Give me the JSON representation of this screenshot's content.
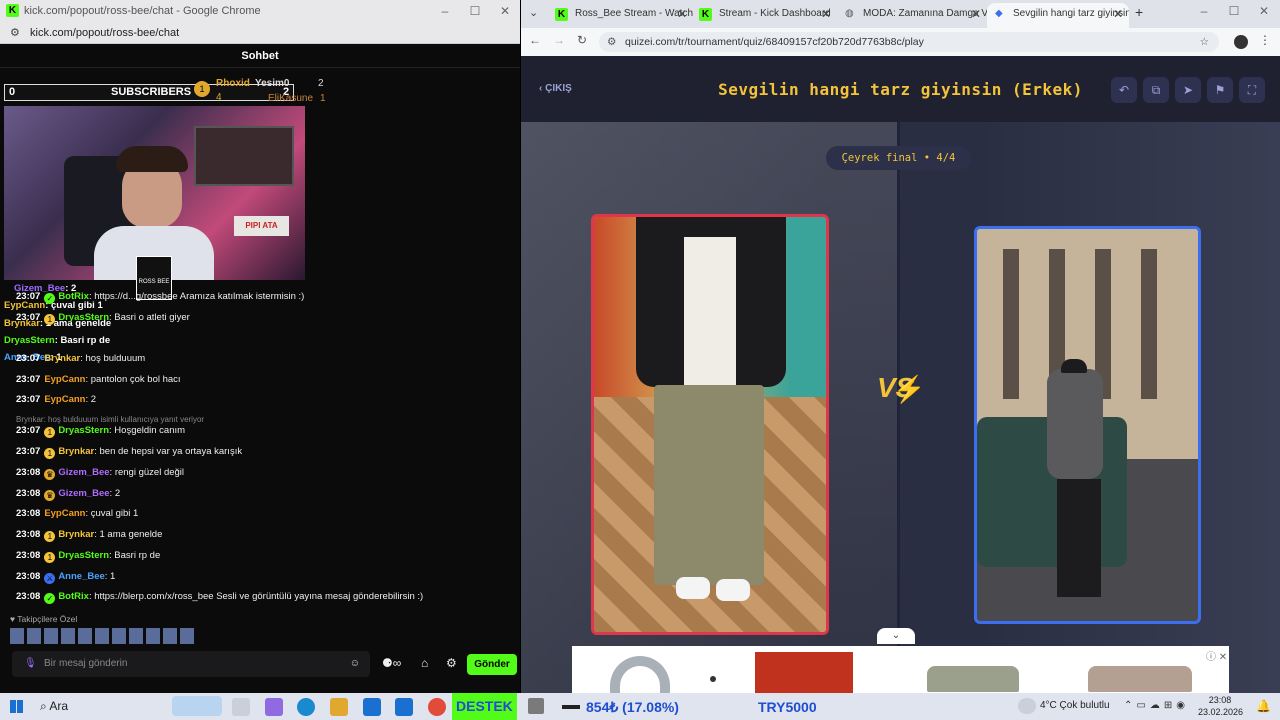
{
  "left_window": {
    "title": "kick.com/popout/ross-bee/chat - Google Chrome",
    "url": "kick.com/popout/ross-bee/chat",
    "chat_header": "Sohbet",
    "overlay": {
      "subs_count": "0",
      "subs_label": "SUBSCRIBERS",
      "subs_right": "2",
      "leader1": "Rhoxid",
      "leader1_count": "4",
      "leader2": "Yesim0",
      "leader2_count": "2",
      "leader3": "EliKasune",
      "leader3_count": "1",
      "stream_logo": "ROSS BEE"
    },
    "overlay_messages": [
      {
        "user": "Gizem_Bee",
        "text": ": 2",
        "color": "#a06bff"
      },
      {
        "user": "EypCann",
        "text": ": çuval gibi 1",
        "color": "#f3c43a"
      },
      {
        "user": "Brynkar",
        "text": ": 1 ama genelde",
        "color": "#f3c43a"
      },
      {
        "user": "DryasStern",
        "text": ": Basri rp de",
        "color": "#53fc18"
      },
      {
        "user": "Anne_Bee",
        "text": ": 1",
        "color": "#4aa3ff"
      }
    ],
    "messages": [
      {
        "time": "23:07",
        "user": "BotRix",
        "text": ": https://d...g/rossbee Aramıza katılmak istermisin :)",
        "color": "#53fc18"
      },
      {
        "time": "23:07",
        "user": "DryasStern",
        "text": ": Basri o atleti giyer",
        "color": "#53fc18"
      },
      {
        "time": "23:07",
        "user": "Brynkar",
        "text": ": hoş bulduuum",
        "color": "#f3c43a"
      },
      {
        "time": "23:07",
        "user": "EypCann",
        "text": ": pantolon çok bol hacı",
        "color": "#f3a020"
      },
      {
        "time": "23:07",
        "user": "EypCann",
        "text": ": 2",
        "color": "#f3a020"
      },
      {
        "time": "23:07",
        "user": "DryasStern",
        "text": ": Hoşgeldin canım",
        "color": "#53fc18"
      },
      {
        "time": "23:07",
        "user": "Brynkar",
        "text": ": ben de hepsi var ya ortaya karışık",
        "color": "#f3c43a"
      },
      {
        "time": "23:08",
        "user": "Gizem_Bee",
        "text": ": rengi güzel değil",
        "color": "#b06bff"
      },
      {
        "time": "23:08",
        "user": "Gizem_Bee",
        "text": ": 2",
        "color": "#b06bff"
      },
      {
        "time": "23:08",
        "user": "EypCann",
        "text": ": çuval gibi 1",
        "color": "#f3a020"
      },
      {
        "time": "23:08",
        "user": "Brynkar",
        "text": ": 1 ama genelde",
        "color": "#f3c43a"
      },
      {
        "time": "23:08",
        "user": "DryasStern",
        "text": ": Basri rp de",
        "color": "#53fc18"
      },
      {
        "time": "23:08",
        "user": "Anne_Bee",
        "text": ": 1",
        "color": "#4aa3ff"
      },
      {
        "time": "23:08",
        "user": "BotRix",
        "text": ": https://blerp.com/x/ross_bee Sesli ve görüntülü yayına mesaj gönderebilirsin :)",
        "color": "#53fc18"
      }
    ],
    "reply_note": "Brynkar: hoş bulduuum isimli kullanıcıya yanıt veriyor",
    "emote_label": "Takipçilere Özel",
    "input_placeholder": "Bir mesaj gönderin",
    "send_label": "Gönder"
  },
  "right_window": {
    "tabs": [
      {
        "label": "Ross_Bee Stream - Watch Li",
        "icon": "kick-icon"
      },
      {
        "label": "Stream - Kick Dashboard",
        "icon": "kick-icon"
      },
      {
        "label": "MODA: Zamanına Damga V",
        "icon": "globe-icon"
      },
      {
        "label": "Sevgilin hangi tarz giyinsin",
        "icon": "quiz-icon"
      }
    ],
    "url": "quizei.com/tr/tournament/quiz/68409157cf20b720d7763b8c/play",
    "exit_label": "ÇIKIŞ",
    "quiz_title": "Sevgilin hangi tarz giyinsin (Erkek)",
    "round_label": "Çeyrek final • 4/4",
    "vs_label": "VS"
  },
  "taskbar": {
    "search_label": "Ara",
    "ticker1": "DESTEK",
    "ticker2": "854₺ (17.08%)",
    "ticker3": "TRY5000",
    "weather": "4°C  Çok bulutlu",
    "time": "23:08",
    "date": "23.02.2026"
  }
}
